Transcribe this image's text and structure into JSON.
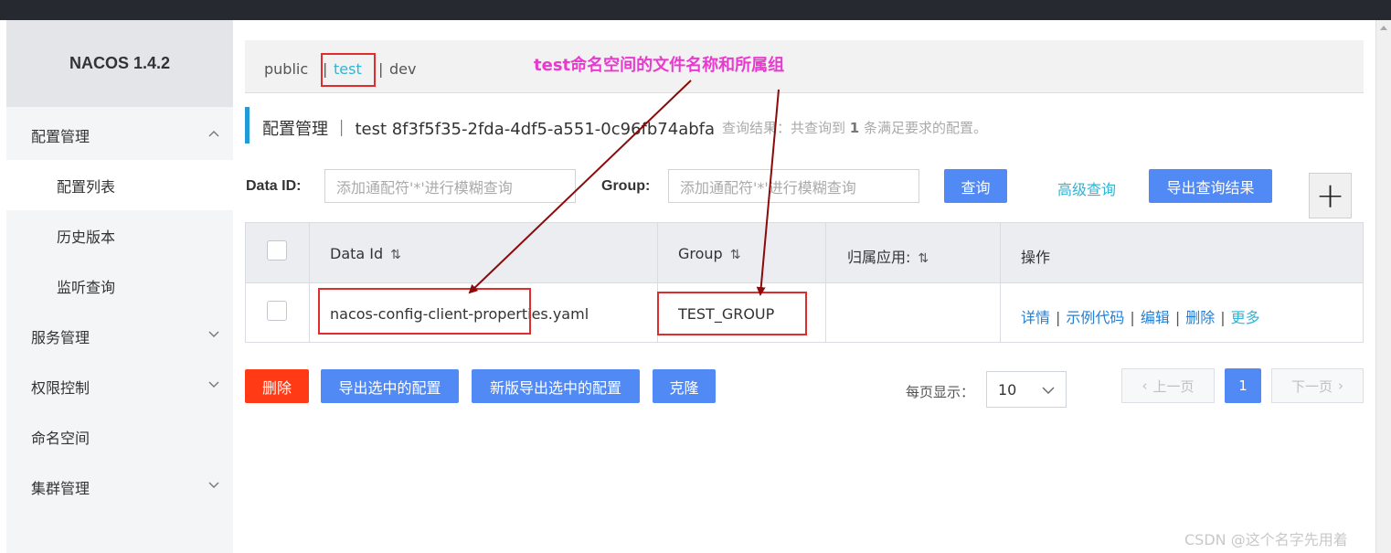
{
  "app": {
    "brand": "NACOS 1.4.2"
  },
  "sidebar": {
    "items": [
      {
        "label": "配置管理"
      },
      {
        "label": "配置列表"
      },
      {
        "label": "历史版本"
      },
      {
        "label": "监听查询"
      },
      {
        "label": "服务管理"
      },
      {
        "label": "权限控制"
      },
      {
        "label": "命名空间"
      },
      {
        "label": "集群管理"
      }
    ]
  },
  "namespaces": {
    "items": [
      {
        "label": "public"
      },
      {
        "label": "test"
      },
      {
        "label": "dev"
      }
    ],
    "separator": "|",
    "active": "test"
  },
  "annotation": "test命名空间的文件名称和所属组",
  "header": {
    "title": "配置管理 ｜ test  8f3f5f35-2fda-4df5-a551-0c96fb74abfa",
    "result_prefix": "查询结果：共查询到",
    "result_count": "1",
    "result_suffix": "条满足要求的配置。"
  },
  "search": {
    "dataid_label": "Data ID:",
    "dataid_placeholder": "添加通配符'*'进行模糊查询",
    "group_label": "Group:",
    "group_placeholder": "添加通配符'*'进行模糊查询",
    "query_button": "查询",
    "advanced_link": "高级查询",
    "export_button": "导出查询结果",
    "add_button": "+"
  },
  "table": {
    "headers": {
      "data_id": "Data Id",
      "group": "Group",
      "app": "归属应用:",
      "ops": "操作"
    },
    "sort_glyph": "⇅",
    "rows": [
      {
        "data_id": "nacos-config-client-properties.yaml",
        "group": "TEST_GROUP",
        "app": ""
      }
    ],
    "ops": [
      "详情",
      "示例代码",
      "编辑",
      "删除",
      "更多"
    ],
    "ops_sep": "|"
  },
  "actions": {
    "delete": "删除",
    "export_selected": "导出选中的配置",
    "export_selected_new": "新版导出选中的配置",
    "clone": "克隆"
  },
  "pagination": {
    "per_page_label": "每页显示：",
    "per_page_value": "10",
    "prev": "上一页",
    "current": "1",
    "next": "下一页"
  },
  "watermark": "CSDN @这个名字先用着",
  "colors": {
    "accent": "#5189f5",
    "danger": "#ff3a14",
    "link": "#2fb5d5",
    "annotation": "#e83acf",
    "highlight_box": "#e02c2c",
    "arrow": "#8b0a0a"
  }
}
